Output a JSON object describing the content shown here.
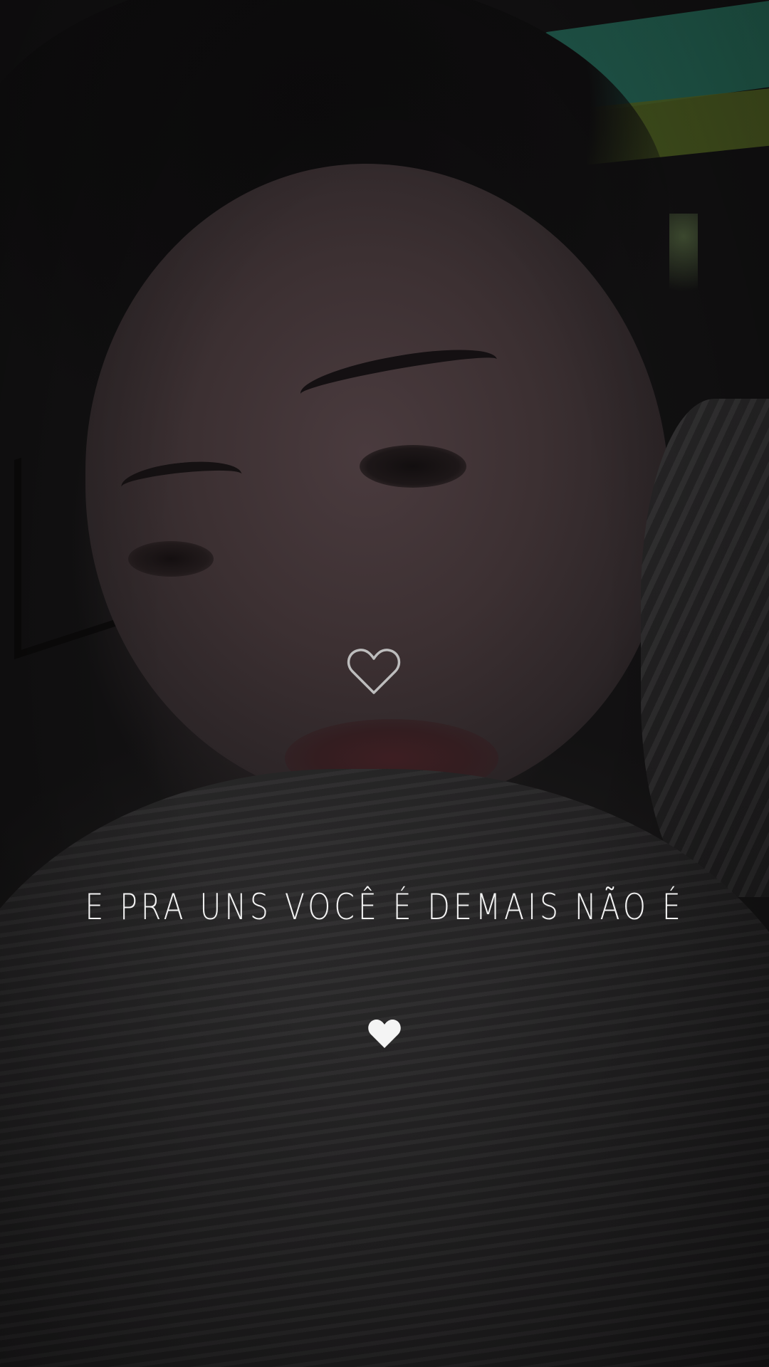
{
  "story": {
    "caption": "E pra uns você é demais não é",
    "colors": {
      "caption_text": "#f2f2f2",
      "heart_outline": "#bdbdbd",
      "heart_emoji": "#f4f4f4",
      "background": "#1a1919"
    },
    "icons": {
      "center_icon": "heart-outline-icon",
      "bottom_icon": "white-heart-emoji-icon"
    }
  }
}
